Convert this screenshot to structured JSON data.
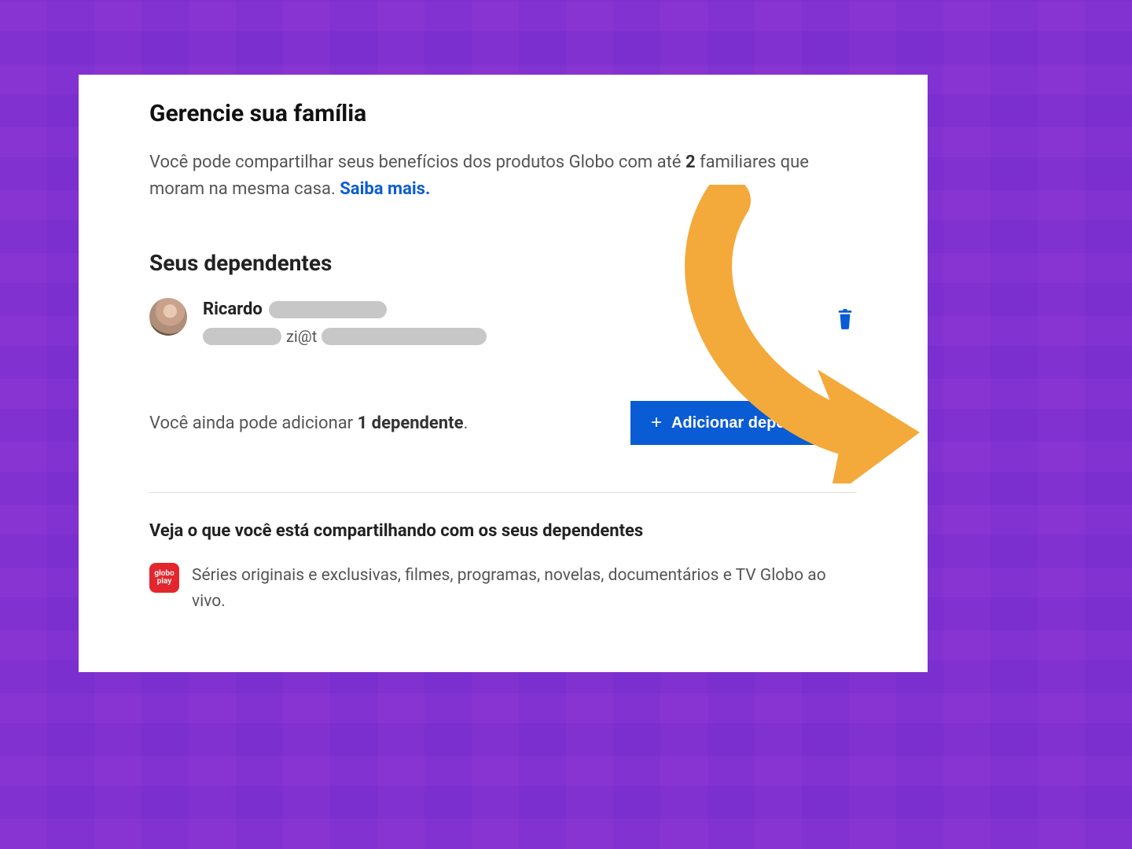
{
  "colors": {
    "accent": "#0a5cd4",
    "bg": "#7b2fce",
    "arrow": "#f4a93b",
    "product_badge": "#e3262e"
  },
  "header": {
    "title": "Gerencie sua família",
    "subtitle_before": "Você pode compartilhar seus benefícios dos produtos Globo com até ",
    "subtitle_bold": "2",
    "subtitle_after": " familiares que moram na mesma casa. ",
    "learn_more": "Saiba mais."
  },
  "dependents": {
    "heading": "Seus dependentes",
    "items": [
      {
        "name": "Ricardo",
        "email_fragment": "zi@t"
      }
    ],
    "trash_label": "Remover dependente"
  },
  "remaining": {
    "before": "Você ainda pode adicionar ",
    "bold": "1 dependente",
    "after": "."
  },
  "add_button_label": "Adicionar dependente",
  "sharing": {
    "heading": "Veja o que você está compartilhando com os seus dependentes",
    "products": [
      {
        "badge_text": "globo play",
        "description": "Séries originais e exclusivas, filmes, programas, novelas, documentários e TV Globo ao vivo."
      }
    ]
  }
}
